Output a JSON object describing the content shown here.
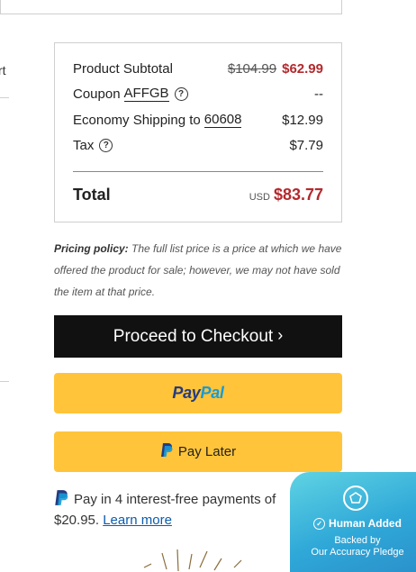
{
  "left_fragment": {
    "cut_text": "rt"
  },
  "summary": {
    "subtotal_label": "Product Subtotal",
    "subtotal_original": "$104.99",
    "subtotal_sale": "$62.99",
    "coupon_label": "Coupon",
    "coupon_code": "AFFGB",
    "coupon_value": "--",
    "shipping_label": "Economy Shipping to",
    "shipping_zip": "60608",
    "shipping_value": "$12.99",
    "tax_label": "Tax",
    "tax_value": "$7.79",
    "total_label": "Total",
    "total_currency": "USD",
    "total_value": "$83.77"
  },
  "policy": {
    "heading": "Pricing policy:",
    "text": "The full list price is a price at which we have offered the product for sale; however, we may not have sold the item at that price."
  },
  "buttons": {
    "checkout_label": "Proceed to Checkout",
    "paypal_part1": "Pay",
    "paypal_part2": "Pal",
    "paylater_label": "Pay Later"
  },
  "installments": {
    "text": "Pay in 4 interest-free payments of $20.95.",
    "link": "Learn more"
  },
  "badge": {
    "title": "Human Added",
    "sub1": "Backed by",
    "sub2": "Our Accuracy Pledge"
  },
  "colors": {
    "sale_red": "#b3292d",
    "checkout_bg": "#111111",
    "paypal_yellow": "#ffc439",
    "paypal_dark_blue": "#253b80",
    "paypal_light_blue": "#179bd7",
    "badge_teal": "#2fa8d8"
  },
  "icons": [
    "help-circle-icon",
    "chevron-right-icon",
    "paypal-p-icon",
    "check-circle-icon",
    "pledge-ring-icon"
  ]
}
